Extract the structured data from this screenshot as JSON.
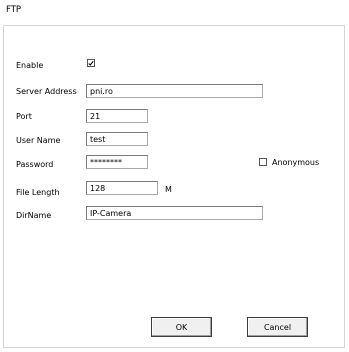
{
  "window": {
    "title": "FTP"
  },
  "form": {
    "enable": {
      "label": "Enable",
      "checked": true
    },
    "server_address": {
      "label": "Server Address",
      "value": "pni.ro"
    },
    "port": {
      "label": "Port",
      "value": "21"
    },
    "user_name": {
      "label": "User Name",
      "value": "test"
    },
    "password": {
      "label": "Password",
      "value": "********"
    },
    "anonymous": {
      "label": "Anonymous",
      "checked": false
    },
    "file_length": {
      "label": "File Length",
      "value": "128",
      "unit": "M"
    },
    "dirname": {
      "label": "DirName",
      "value": "IP-Camera"
    }
  },
  "buttons": {
    "ok": "OK",
    "cancel": "Cancel"
  }
}
